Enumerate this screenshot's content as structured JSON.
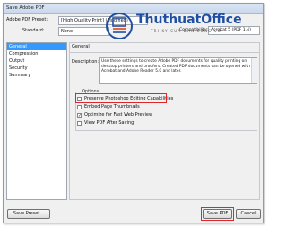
{
  "window": {
    "title": "Save Adobe PDF"
  },
  "header": {
    "preset_label": "Adobe PDF Preset:",
    "preset_value": "[High Quality Print] (Modified)",
    "standard_label": "Standard:",
    "standard_value": "None",
    "compat_label": "Compatibility:",
    "compat_value": "Acrobat 5 (PDF 1.4)"
  },
  "watermark": {
    "brand_part1": "Thuthuat",
    "brand_part2": "Office",
    "tagline": "TRI KY CUA DAN CONG SO",
    "accent_color": "#1e4fa3",
    "accent_color2": "#e8572a"
  },
  "sidebar": {
    "items": [
      {
        "label": "General"
      },
      {
        "label": "Compression"
      },
      {
        "label": "Output"
      },
      {
        "label": "Security"
      },
      {
        "label": "Summary"
      }
    ],
    "selected_index": 0
  },
  "main": {
    "section_title": "General",
    "description_label": "Description:",
    "description_text": "Use these settings to create Adobe PDF documents for quality printing on desktop printers and proofers. Created PDF documents can be opened with Acrobat and Adobe Reader 5.0 and later.",
    "options_label": "Options",
    "options": [
      {
        "label": "Preserve Photoshop Editing Capabilities",
        "checked": false
      },
      {
        "label": "Embed Page Thumbnails",
        "checked": false
      },
      {
        "label": "Optimize for Fast Web Preview",
        "checked": true
      },
      {
        "label": "View PDF After Saving",
        "checked": false
      }
    ]
  },
  "footer": {
    "save_preset_label": "Save Preset...",
    "save_pdf_label": "Save PDF",
    "cancel_label": "Cancel"
  },
  "colors": {
    "highlight": "#e0262a",
    "selection": "#3399ff"
  }
}
